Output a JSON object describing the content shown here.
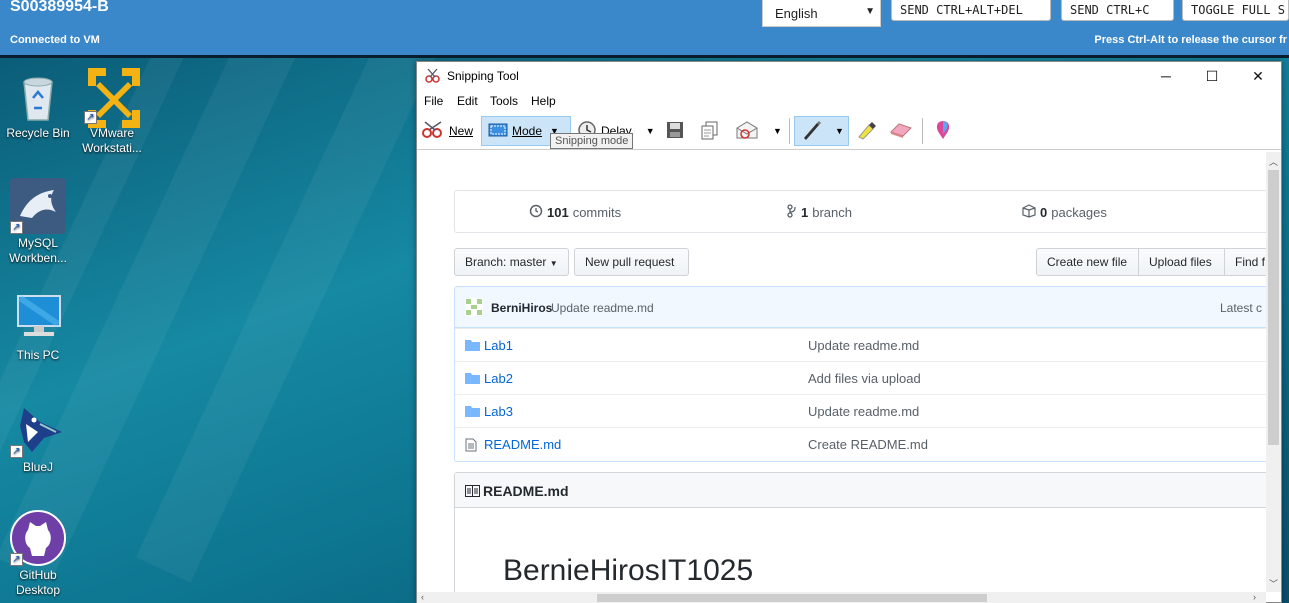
{
  "vm": {
    "title": "S00389954-B",
    "status": "Connected to VM",
    "language": "English",
    "buttons": [
      "SEND CTRL+ALT+DEL",
      "SEND CTRL+C",
      "TOGGLE FULL S"
    ],
    "hint": "Press Ctrl-Alt to release the cursor fr"
  },
  "desktop": {
    "icons": [
      {
        "label": "Recycle Bin",
        "icon": "recycle-bin-icon"
      },
      {
        "label": "VMware Workstati...",
        "icon": "vmware-icon"
      },
      {
        "label": "MySQL Workben...",
        "icon": "mysql-icon"
      },
      {
        "label": "This PC",
        "icon": "computer-icon"
      },
      {
        "label": "BlueJ",
        "icon": "bluej-icon"
      },
      {
        "label": "GitHub Desktop",
        "icon": "github-icon"
      }
    ]
  },
  "snip": {
    "title": "Snipping Tool",
    "menu": [
      "File",
      "Edit",
      "Tools",
      "Help"
    ],
    "toolbar": {
      "new": "New",
      "mode": "Mode",
      "delay": "Delay"
    },
    "tooltip": "Snipping mode"
  },
  "repo": {
    "commits_count": "101",
    "commits_label": "commits",
    "branch_count": "1",
    "branch_label": "branch",
    "packages_count": "0",
    "packages_label": "packages",
    "branch_button": "Branch: master",
    "new_pr": "New pull request",
    "create_file": "Create new file",
    "upload_files": "Upload files",
    "find_file": "Find f",
    "commit_author": "BerniHiros",
    "commit_message": "Update readme.md",
    "latest": "Latest c",
    "files": [
      {
        "name": "Lab1",
        "type": "folder",
        "message": "Update readme.md"
      },
      {
        "name": "Lab2",
        "type": "folder",
        "message": "Add files via upload"
      },
      {
        "name": "Lab3",
        "type": "folder",
        "message": "Update readme.md"
      },
      {
        "name": "README.md",
        "type": "file",
        "message": "Create README.md"
      }
    ],
    "readme_header": "README.md",
    "readme_title": "BernieHirosIT1025"
  }
}
